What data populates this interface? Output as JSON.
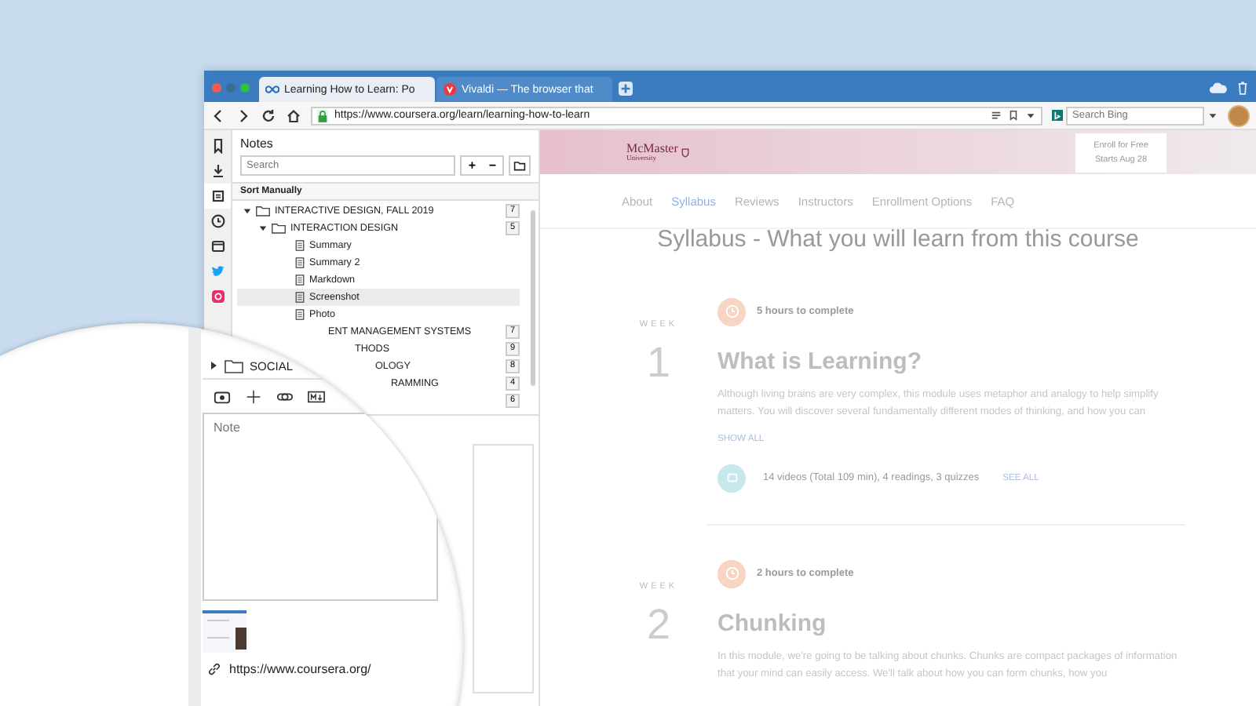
{
  "browser": {
    "tabs": [
      {
        "title": "Learning How to Learn: Po",
        "kind": "course",
        "selected": true
      },
      {
        "title": "Vivaldi — The browser that",
        "kind": "round",
        "selected": false
      }
    ],
    "url": "https://www.coursera.org/learn/learning-how-to-learn",
    "search": {
      "placeholder": "Search Bing"
    }
  },
  "side_strip": {
    "items": [
      {
        "kind": "bookmarks",
        "selected": false
      },
      {
        "kind": "downloads",
        "selected": false
      },
      {
        "kind": "notes",
        "selected": true
      },
      {
        "kind": "history",
        "selected": false
      },
      {
        "kind": "window",
        "selected": false
      },
      {
        "kind": "bird",
        "selected": false
      },
      {
        "kind": "camera",
        "selected": false
      }
    ]
  },
  "notes": {
    "title": "Notes",
    "search": {
      "placeholder": "Search"
    },
    "add": "+",
    "remove": "−",
    "sort": "Sort Manually",
    "tree": [
      {
        "kind": "folder",
        "label": "INTERACTIVE DESIGN, FALL 2019",
        "count": "7",
        "expanded": true,
        "children": [
          {
            "kind": "folder",
            "label": "INTERACTION DESIGN",
            "count": "5",
            "expanded": true,
            "children": [
              {
                "kind": "note",
                "label": "Summary",
                "selected": false
              },
              {
                "kind": "note",
                "label": "Summary 2",
                "selected": false
              },
              {
                "kind": "note",
                "label": "Markdown",
                "selected": false
              },
              {
                "kind": "note",
                "label": "Screenshot",
                "selected": true
              },
              {
                "kind": "note",
                "label": "Photo",
                "selected": false
              }
            ]
          }
        ]
      },
      {
        "kind": "folder",
        "label": "ENT MANAGEMENT SYSTEMS",
        "count": "7"
      },
      {
        "kind": "folder",
        "label": "THODS",
        "count": "9"
      },
      {
        "kind": "folder",
        "label": "OLOGY",
        "count": "8"
      },
      {
        "kind": "folder",
        "label": "RAMMING",
        "count": "4"
      },
      {
        "kind": "folder",
        "count": "6"
      }
    ]
  },
  "magnifier": {
    "tree_row": {
      "label": "SOCIAL",
      "expanded": false
    },
    "note": {
      "placeholder": "Note"
    },
    "url": "https://www.coursera.org/"
  },
  "page": {
    "logo": {
      "name": "McMaster",
      "sub": "University"
    },
    "enroll": {
      "label": "Enroll for Free",
      "sub": "Starts Aug 28"
    },
    "nav": [
      {
        "label": "About",
        "selected": false
      },
      {
        "label": "Syllabus",
        "selected": true
      },
      {
        "label": "Reviews",
        "selected": false
      },
      {
        "label": "Instructors",
        "selected": false
      },
      {
        "label": "Enrollment Options",
        "selected": false
      },
      {
        "label": "FAQ",
        "selected": false
      }
    ],
    "heading": "Syllabus - What you will learn from this course",
    "weeks": [
      {
        "label": "WEEK",
        "number": "1",
        "hours": "5 hours to complete",
        "title": "What is Learning?",
        "description": "Although living brains are very complex, this module uses metaphor and analogy to help simplify matters. You will discover several fundamentally different modes of thinking, and how you can",
        "show_all": "SHOW ALL",
        "materials": "14 videos (Total 109 min), 4 readings, 3 quizzes",
        "see_all": "SEE ALL"
      },
      {
        "label": "WEEK",
        "number": "2",
        "hours": "2 hours to complete",
        "title": "Chunking",
        "description": "In this module, we're going to be talking about chunks. Chunks are compact packages of information that your mind can easily access. We'll talk about how you can form chunks, how you"
      }
    ]
  }
}
